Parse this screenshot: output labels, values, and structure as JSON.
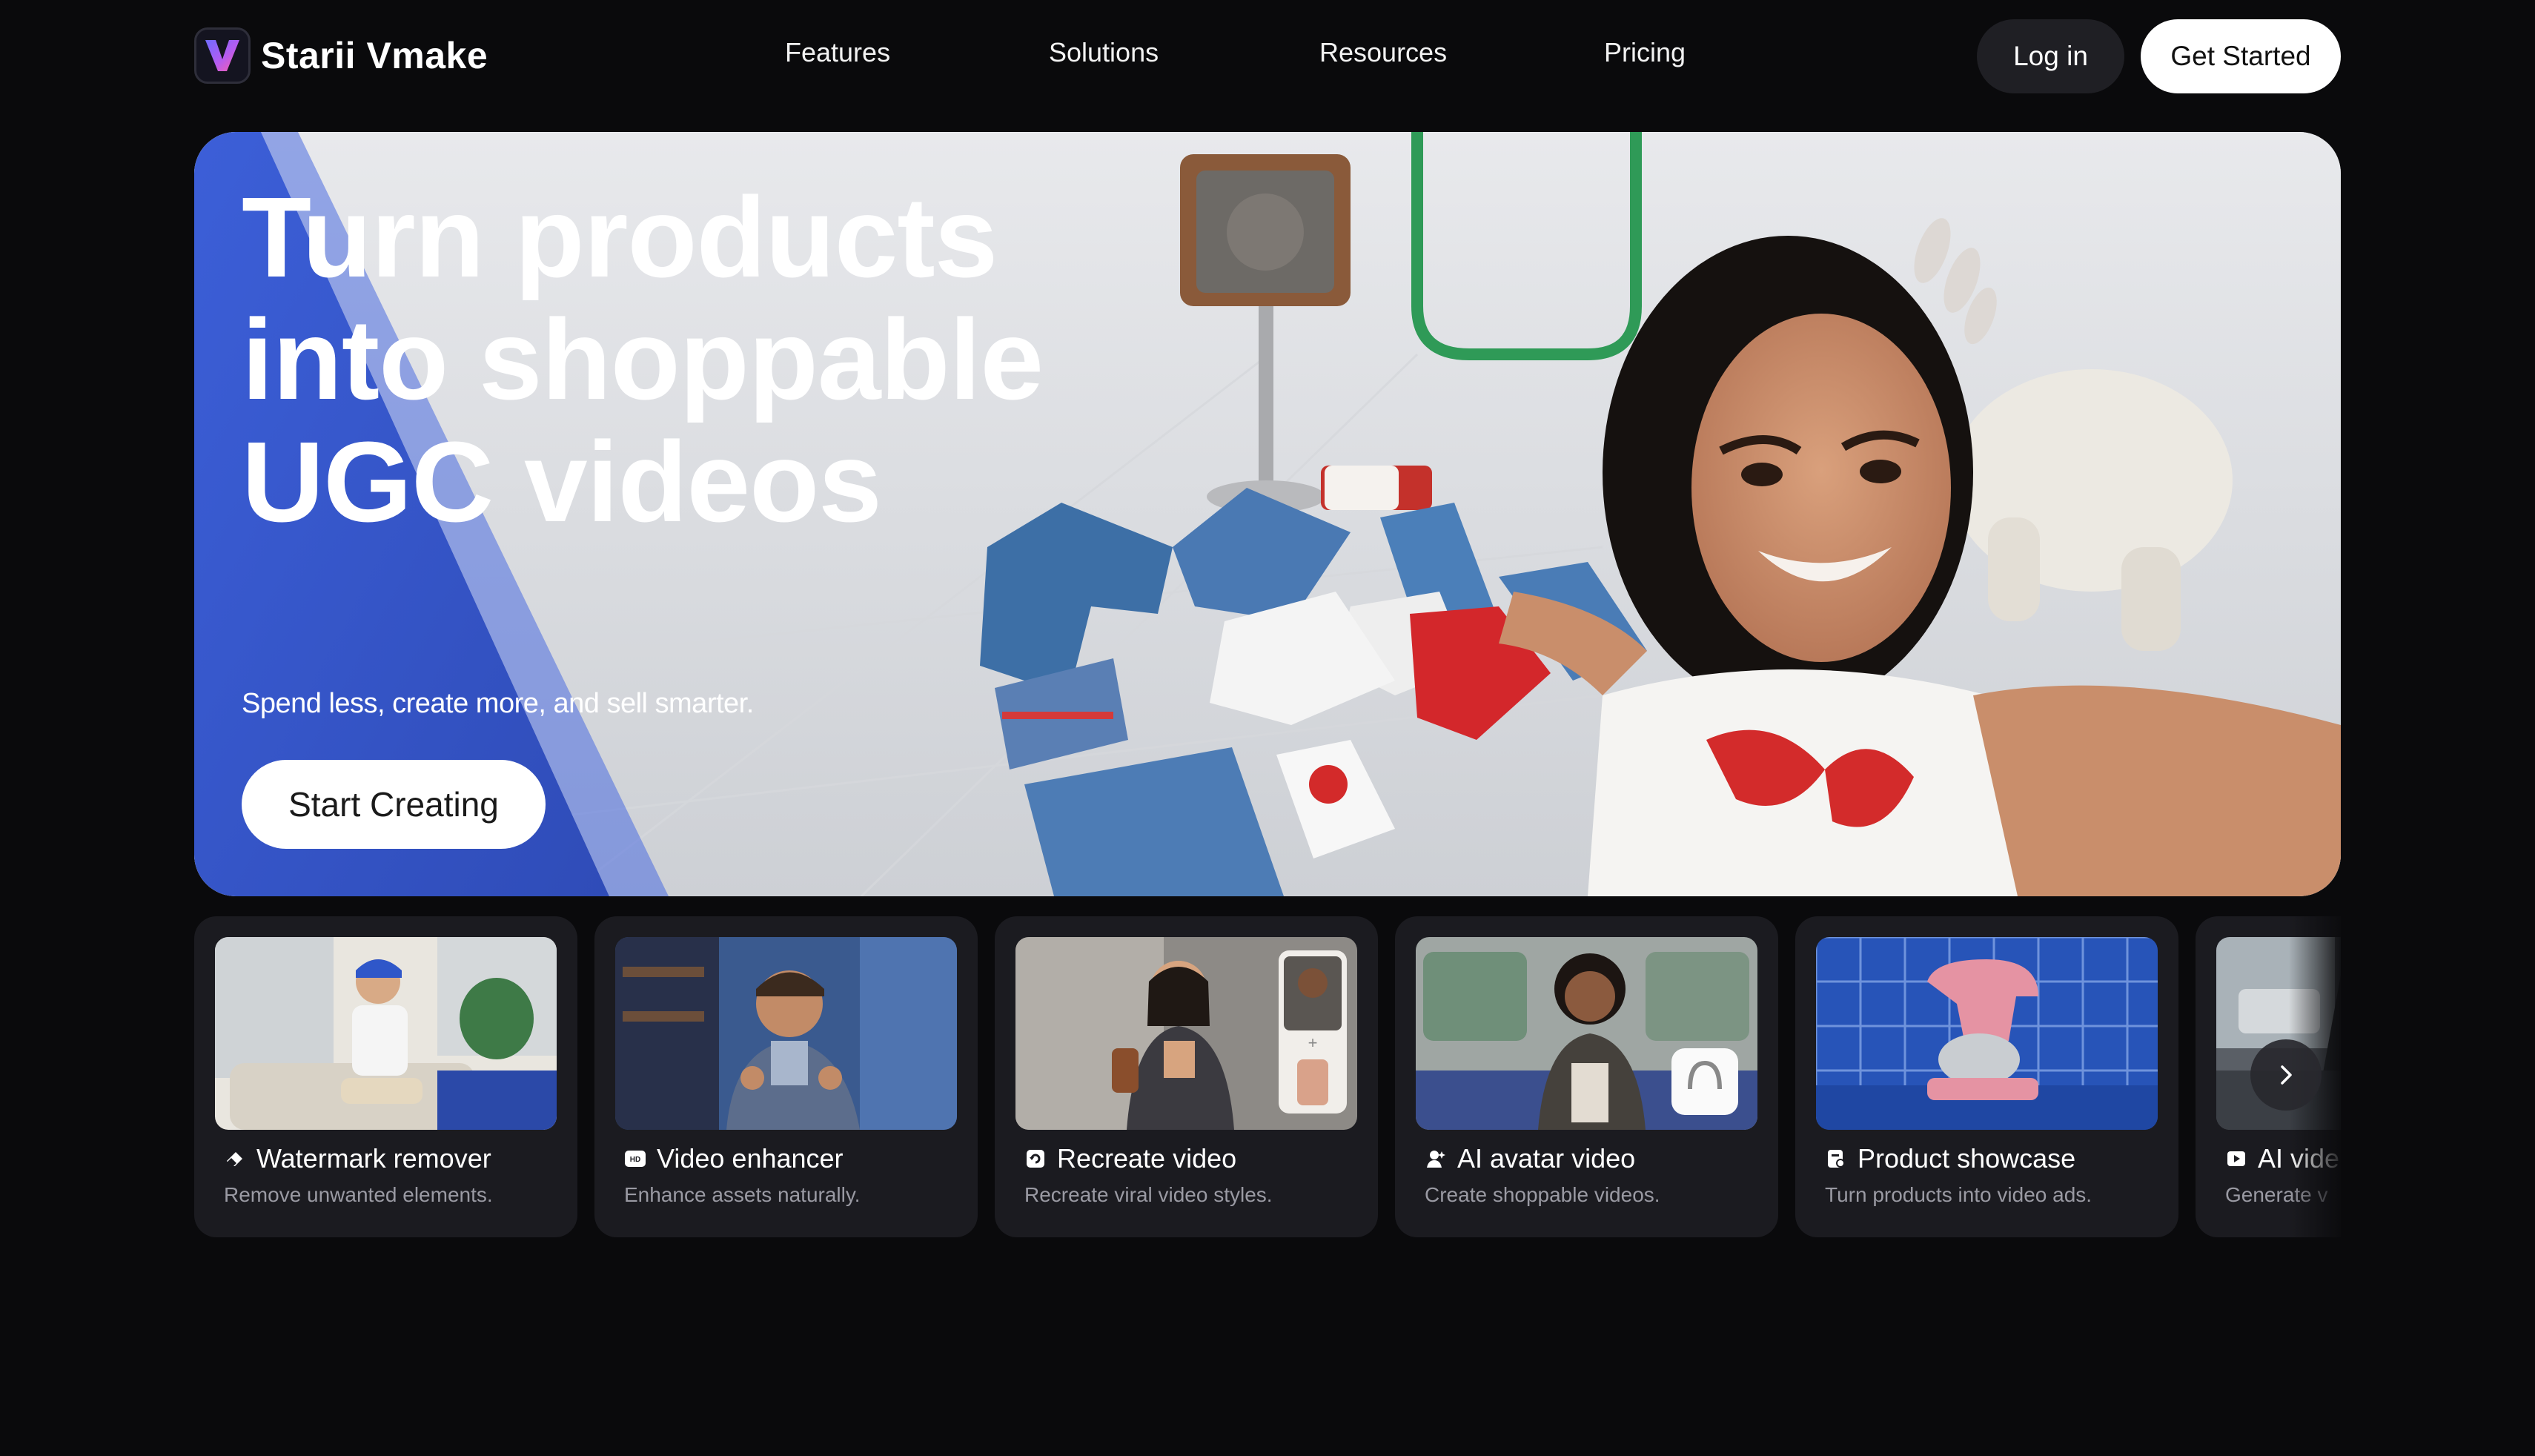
{
  "brand": {
    "name": "Starii Vmake",
    "logo_icon": "vmake-v-logo"
  },
  "nav": {
    "links": [
      {
        "label": "Features"
      },
      {
        "label": "Solutions"
      },
      {
        "label": "Resources"
      },
      {
        "label": "Pricing"
      }
    ],
    "login_label": "Log in",
    "get_started_label": "Get Started"
  },
  "hero": {
    "title_lines": [
      "Turn products",
      "into shoppable",
      "UGC videos"
    ],
    "subtitle": "Spend less, create more, and sell smarter.",
    "cta_label": "Start Creating",
    "accent_color": "#3b5bd6"
  },
  "cards": [
    {
      "title": "Watermark remover",
      "desc": "Remove unwanted elements.",
      "icon": "eraser-icon"
    },
    {
      "title": "Video enhancer",
      "desc": "Enhance assets naturally.",
      "icon": "hd-icon"
    },
    {
      "title": "Recreate video",
      "desc": "Recreate viral video styles.",
      "icon": "recreate-icon"
    },
    {
      "title": "AI avatar video",
      "desc": "Create shoppable videos.",
      "icon": "avatar-icon"
    },
    {
      "title": "Product showcase",
      "desc": "Turn products into video ads.",
      "icon": "product-icon"
    },
    {
      "title": "AI vide",
      "desc": "Generate v",
      "icon": "play-video-icon"
    }
  ],
  "carousel": {
    "next_icon": "chevron-right-icon"
  }
}
